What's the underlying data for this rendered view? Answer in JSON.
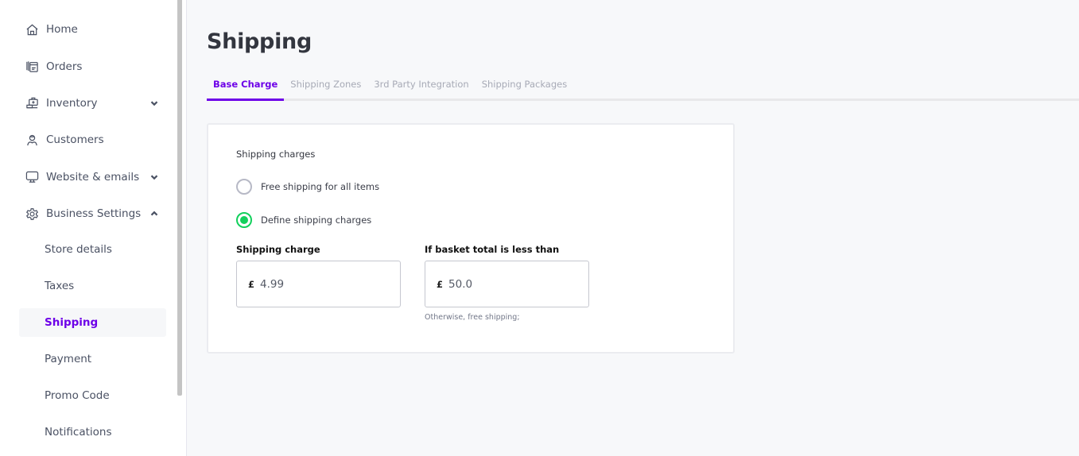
{
  "sidebar": {
    "items": [
      {
        "label": "Home",
        "icon": "home-icon"
      },
      {
        "label": "Orders",
        "icon": "orders-icon"
      },
      {
        "label": "Inventory",
        "icon": "inventory-icon",
        "expandable": true,
        "expanded": false
      },
      {
        "label": "Customers",
        "icon": "customers-icon"
      },
      {
        "label": "Website & emails",
        "icon": "monitor-icon",
        "expandable": true,
        "expanded": false
      },
      {
        "label": "Business Settings",
        "icon": "gear-icon",
        "expandable": true,
        "expanded": true
      }
    ],
    "sub_items": [
      {
        "label": "Store details"
      },
      {
        "label": "Taxes"
      },
      {
        "label": "Shipping",
        "active": true
      },
      {
        "label": "Payment"
      },
      {
        "label": "Promo Code"
      },
      {
        "label": "Notifications"
      }
    ]
  },
  "main": {
    "title": "Shipping",
    "tabs": [
      {
        "label": "Base Charge",
        "active": true
      },
      {
        "label": "Shipping Zones"
      },
      {
        "label": "3rd Party Integration"
      },
      {
        "label": "Shipping Packages"
      }
    ],
    "card": {
      "section_title": "Shipping charges",
      "options": [
        {
          "label": "Free shipping for all items",
          "checked": false
        },
        {
          "label": "Define shipping charges",
          "checked": true
        }
      ],
      "fields": [
        {
          "label": "Shipping charge",
          "currency": "£",
          "value": "4.99",
          "hint": ""
        },
        {
          "label": "If basket total is less than",
          "currency": "£",
          "value": "50.0",
          "hint": "Otherwise, free shipping;"
        }
      ]
    }
  },
  "colors": {
    "accent": "#6d00e8",
    "radio_checked": "#12d05c",
    "background": "#f7f8fa"
  }
}
